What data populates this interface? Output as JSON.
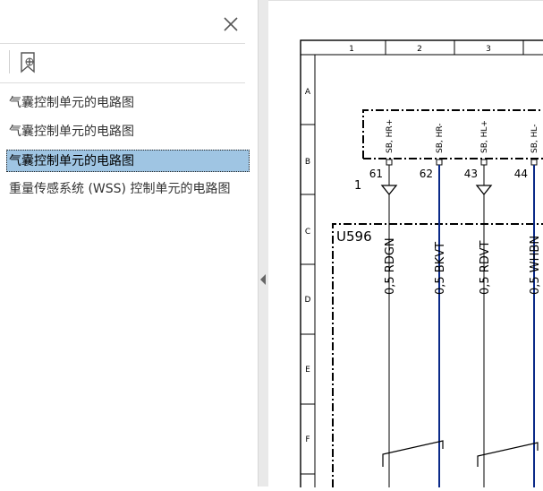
{
  "bookmarks_panel": {
    "items": [
      {
        "label": "气囊控制单元的电路图"
      },
      {
        "label": "气囊控制单元的电路图"
      },
      {
        "label": "气囊控制单元的电路图"
      },
      {
        "label": "重量传感系统 (WSS) 控制单元的电路图"
      }
    ],
    "selected_index": 2
  },
  "icons": {
    "close": "close-icon",
    "bookmark_add": "bookmark-add-icon",
    "collapse": "collapse-arrow-icon"
  },
  "diagram": {
    "columns": [
      "1",
      "2",
      "3"
    ],
    "rows": [
      "A",
      "B",
      "C",
      "D",
      "E",
      "F"
    ],
    "connector_label": "1",
    "component": "U596",
    "pins": [
      {
        "label": "SB, HR+",
        "number": "61",
        "wire": "0,5 RDGN",
        "color": "#000000"
      },
      {
        "label": "SB, HR-",
        "number": "62",
        "wire": "0,5 BKVT",
        "color": "#0b2a88"
      },
      {
        "label": "SB, HL+",
        "number": "43",
        "wire": "0,5 RDVT",
        "color": "#000000"
      },
      {
        "label": "SB, HL-",
        "number": "44",
        "wire": "0,5 WHBN",
        "color": "#0b2a88"
      }
    ]
  }
}
